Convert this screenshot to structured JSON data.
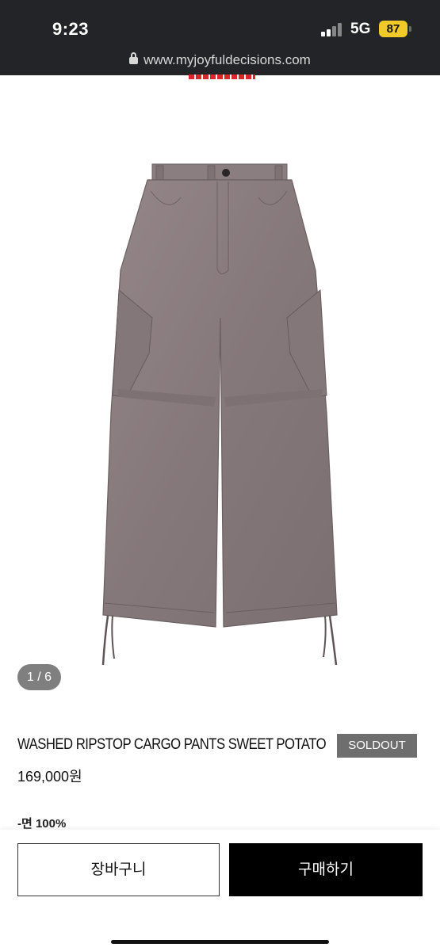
{
  "status_bar": {
    "time": "9:23",
    "network": "5G",
    "battery": "87",
    "battery_color": "#f1c928"
  },
  "browser": {
    "url": "www.myjoyfuldecisions.com"
  },
  "gallery": {
    "counter": "1 / 6",
    "product_color": "#8a7d7f"
  },
  "product": {
    "name": "WASHED RIPSTOP CARGO PANTS SWEET POTATO",
    "status_badge": "SOLDOUT",
    "price": "169,000원",
    "material": "-면 100%"
  },
  "actions": {
    "cart_label": "장바구니",
    "buy_label": "구매하기"
  },
  "colors": {
    "topbar_bg": "#232427",
    "brand_accent": "#d8262a",
    "buy_button_bg": "#000000",
    "soldout_bg": "#6e6e6e"
  }
}
